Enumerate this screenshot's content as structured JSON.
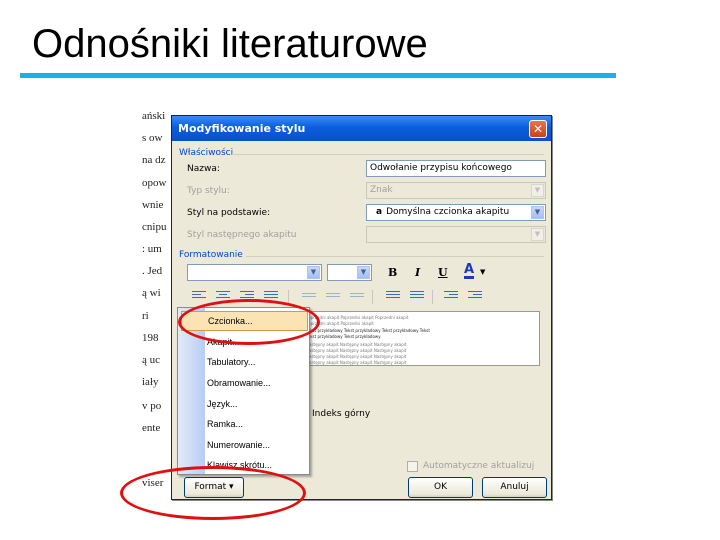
{
  "slide": {
    "title": "Odnośniki literaturowe"
  },
  "doc_bg": {
    "lines": [
      "ański",
      "s ow",
      "na dz",
      "opow",
      "wnie",
      "cnipu",
      ": um",
      ". Jed",
      "ą wi",
      "ri",
      "198",
      "ą uc",
      "iały",
      "v po",
      "ente",
      "viser"
    ]
  },
  "dialog": {
    "title": "Modyfikowanie stylu",
    "close_glyph": "✕",
    "properties_group": "Właściwości",
    "name_label": "Nazwa:",
    "name_value": "Odwołanie przypisu końcowego",
    "style_type_label": "Typ stylu:",
    "style_type_value": "Znak",
    "based_on_label": "Styl na podstawie:",
    "based_on_value": "Domyślna czcionka akapitu",
    "based_on_mark": "a",
    "next_style_label": "Styl następnego akapitu",
    "next_style_value": "",
    "formatting_group": "Formatowanie",
    "font_value": "",
    "size_value": "",
    "bold": "B",
    "italic": "I",
    "underline": "U",
    "font_color": "A",
    "preview_lines": [
      "Poprzedni akapit Poprzedni akapit Poprzedni akapit",
      "Poprzedni akapit Poprzedni akapit",
      "Tekst przykładowy Tekst przykładowy Tekst przykładowy Tekst",
      "Tekst przykładowy Tekst przykładowy",
      "Następny akapit Następny akapit Następny akapit",
      "Następny akapit Następny akapit Następny akapit",
      "Następny akapit Następny akapit Następny akapit",
      "Następny akapit Następny akapit Następny akapit"
    ],
    "description": "Indeks górny",
    "auto_update_label": "Automatyczne aktualizuj",
    "format_button": "Format",
    "format_caret": "▾",
    "ok_button": "OK",
    "cancel_button": "Anuluj"
  },
  "format_menu": {
    "items": [
      "Czcionka...",
      "Akapit...",
      "Tabulatory...",
      "Obramowanie...",
      "Język...",
      "Ramka...",
      "Numerowanie...",
      "Klawisz skrótu..."
    ],
    "highlighted_index": 0
  },
  "colors": {
    "title_rule": "#1cb0e8",
    "highlight": "#e01010",
    "titlebar": "#0b5ee0"
  }
}
